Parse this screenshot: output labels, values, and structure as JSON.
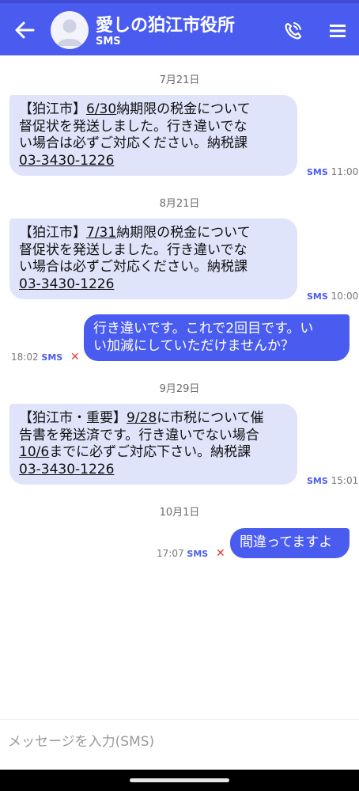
{
  "header": {
    "contact_name": "愛しの狛江市役所",
    "contact_sub": "SMS",
    "colors": {
      "primary": "#4a5cf0",
      "incoming_bubble": "#dfe4fb"
    },
    "icons": {
      "back": "arrow-left-icon",
      "avatar": "person-avatar-icon",
      "call": "phone-call-icon",
      "menu": "hamburger-menu-icon"
    }
  },
  "conversation": {
    "dates": [
      "7月21日",
      "8月21日",
      "9月29日",
      "10月1日"
    ],
    "messages": [
      {
        "direction": "incoming",
        "lines": [
          [
            {
              "t": "【狛江市】"
            },
            {
              "t": "6/30",
              "u": true
            },
            {
              "t": "納期限の税金について"
            }
          ],
          [
            {
              "t": "督促状を発送しました。行き違いでな"
            }
          ],
          [
            {
              "t": "い場合は必ずご対応ください。納税課"
            }
          ],
          [
            {
              "t": "03-3430-1226",
              "u": true
            }
          ]
        ],
        "channel": "SMS",
        "time": "11:00"
      },
      {
        "direction": "incoming",
        "lines": [
          [
            {
              "t": "【狛江市】"
            },
            {
              "t": "7/31",
              "u": true
            },
            {
              "t": "納期限の税金について"
            }
          ],
          [
            {
              "t": "督促状を発送しました。行き違いでな"
            }
          ],
          [
            {
              "t": "い場合は必ずご対応ください。納税課"
            }
          ],
          [
            {
              "t": "03-3430-1226",
              "u": true
            }
          ]
        ],
        "channel": "SMS",
        "time": "10:00"
      },
      {
        "direction": "outgoing",
        "lines": [
          [
            {
              "t": "行き違いです。これで2回目です。い"
            }
          ],
          [
            {
              "t": "い加減にしていただけませんか？"
            }
          ]
        ],
        "channel": "SMS",
        "time": "18:02",
        "failed_mark": "✕"
      },
      {
        "direction": "incoming",
        "lines": [
          [
            {
              "t": "【狛江市・重要】"
            },
            {
              "t": "9/28",
              "u": true
            },
            {
              "t": "に市税について催"
            }
          ],
          [
            {
              "t": "告書を発送済です。行き違いでない場合"
            }
          ],
          [
            {
              "t": "10/6",
              "u": true
            },
            {
              "t": "までに必ずご対応下さい。納税課"
            }
          ],
          [
            {
              "t": "03-3430-1226",
              "u": true
            }
          ]
        ],
        "channel": "SMS",
        "time": "15:01"
      },
      {
        "direction": "outgoing",
        "lines": [
          [
            {
              "t": "間違ってますよ"
            }
          ]
        ],
        "channel": "SMS",
        "time": "17:07",
        "failed_mark": "✕"
      }
    ]
  },
  "composer": {
    "placeholder": "メッセージを入力(SMS)",
    "value": ""
  }
}
